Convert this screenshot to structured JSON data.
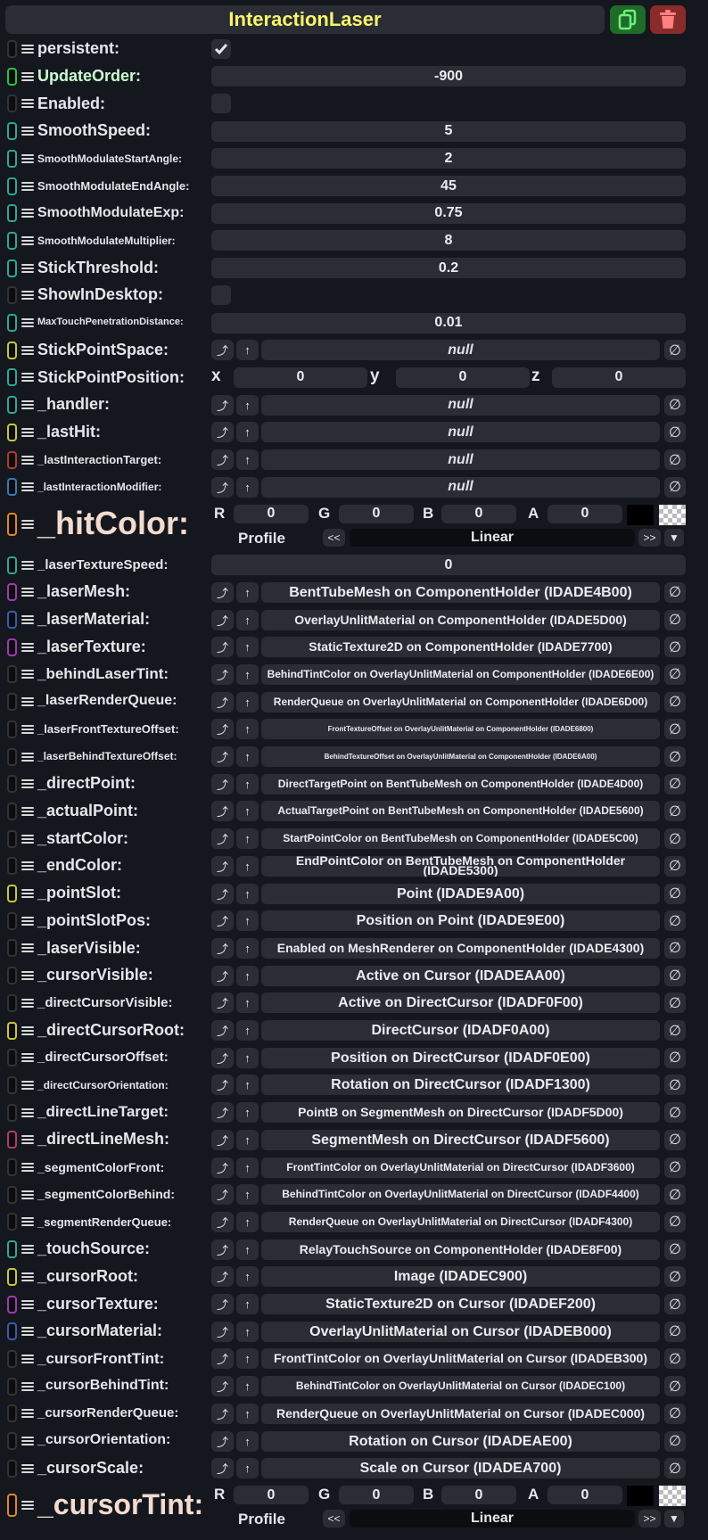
{
  "component": {
    "title": "InteractionLaser",
    "duplicate_icon": "duplicate-icon",
    "delete_icon": "trash-icon"
  },
  "colors": {
    "title": "#f7f56a",
    "panel": "#15171e",
    "field": "#2b2d35",
    "duplicate_button": "#1f6b2a",
    "delete_button": "#8a2b2b",
    "label_value_type": "#c9ffd0",
    "label_color_field": "#f3dccf"
  },
  "icons": {
    "drag": "drag-handle-icon",
    "checkmark": "checkmark-icon",
    "open": "open-reference-icon",
    "up": "up-arrow-icon",
    "clear": "clear-null-icon",
    "dropdown": "dropdown-arrow-icon"
  },
  "ref_buttons": {
    "open": "⤴",
    "up": "↑",
    "clear": "∅"
  },
  "color_field": {
    "r": "R",
    "g": "G",
    "b": "B",
    "a": "A",
    "profile": "Profile",
    "prev": "<<",
    "next": ">>",
    "arrow": "▼"
  },
  "vector_axes": {
    "x": "x",
    "y": "y",
    "z": "z"
  },
  "rows": [
    {
      "label": "persistent:",
      "type": "bool",
      "checked": true,
      "pill": "#333333",
      "size": 18
    },
    {
      "label": "UpdateOrder:",
      "type": "value",
      "value": "-900",
      "pill": "#2cc43a",
      "size": 18,
      "color": "#c9ffd0"
    },
    {
      "label": "Enabled:",
      "type": "bool",
      "checked": false,
      "pill": "#333333",
      "size": 18
    },
    {
      "label": "SmoothSpeed:",
      "type": "value",
      "value": "5",
      "pill": "#2aa89a",
      "size": 18
    },
    {
      "label": "SmoothModulateStartAngle:",
      "type": "value",
      "value": "2",
      "pill": "#2aa89a",
      "size": 12
    },
    {
      "label": "SmoothModulateEndAngle:",
      "type": "value",
      "value": "45",
      "pill": "#2aa89a",
      "size": 13
    },
    {
      "label": "SmoothModulateExp:",
      "type": "value",
      "value": "0.75",
      "pill": "#2aa89a",
      "size": 16
    },
    {
      "label": "SmoothModulateMultiplier:",
      "type": "value",
      "value": "8",
      "pill": "#2aa89a",
      "size": 12
    },
    {
      "label": "StickThreshold:",
      "type": "value",
      "value": "0.2",
      "pill": "#2aa89a",
      "size": 18
    },
    {
      "label": "ShowInDesktop:",
      "type": "bool",
      "checked": false,
      "pill": "#333333",
      "size": 18
    },
    {
      "label": "MaxTouchPenetrationDistance:",
      "type": "value",
      "value": "0.01",
      "pill": "#2aa89a",
      "size": 11
    },
    {
      "label": "StickPointSpace:",
      "type": "ref",
      "value": "null",
      "pill": "#c9c63a",
      "size": 18
    },
    {
      "label": "StickPointPosition:",
      "type": "vec3",
      "x": "0",
      "y": "0",
      "z": "0",
      "pill": "#2aa89a",
      "size": 18
    },
    {
      "label": "_handler:",
      "type": "ref",
      "value": "null",
      "pill": "#2aa89a",
      "size": 18
    },
    {
      "label": "_lastHit:",
      "type": "ref",
      "value": "null",
      "pill": "#c9c63a",
      "size": 18
    },
    {
      "label": "_lastInteractionTarget:",
      "type": "ref",
      "value": "null",
      "pill": "#b03a2e",
      "size": 13
    },
    {
      "label": "_lastInteractionModifier:",
      "type": "ref",
      "value": "null",
      "pill": "#3a7ab0",
      "size": 12
    },
    {
      "label": "_hitColor:",
      "type": "color",
      "r": "0",
      "g": "0",
      "b": "0",
      "a": "0",
      "profile": "Linear",
      "pill": "#e0871f",
      "size": 36
    },
    {
      "label": "_laserTextureSpeed:",
      "type": "value",
      "value": "0",
      "pill": "#2aa89a",
      "size": 15
    },
    {
      "label": "_laserMesh:",
      "type": "ref",
      "value": "BentTubeMesh on ComponentHolder (IDADE4B00)",
      "pill": "#a03ab0",
      "size": 18
    },
    {
      "label": "_laserMaterial:",
      "type": "ref",
      "value": "OverlayUnlitMaterial on ComponentHolder (IDADE5D00)",
      "pill": "#3a5ab0",
      "size": 18
    },
    {
      "label": "_laserTexture:",
      "type": "ref",
      "value": "StaticTexture2D on ComponentHolder (IDADE7700)",
      "pill": "#a03ab0",
      "size": 18
    },
    {
      "label": "_behindLaserTint:",
      "type": "ref",
      "value": "BehindTintColor on OverlayUnlitMaterial on ComponentHolder (IDADE6E00)",
      "pill": "#333333",
      "size": 17
    },
    {
      "label": "_laserRenderQueue:",
      "type": "ref",
      "value": "RenderQueue on OverlayUnlitMaterial on ComponentHolder (IDADE6D00)",
      "pill": "#333333",
      "size": 16
    },
    {
      "label": "_laserFrontTextureOffset:",
      "type": "ref",
      "value": "FrontTextureOffset on OverlayUnlitMaterial on ComponentHolder (IDADE6800)",
      "pill": "#333333",
      "size": 13,
      "small": true
    },
    {
      "label": "_laserBehindTextureOffset:",
      "type": "ref",
      "value": "BehindTextureOffset on OverlayUnlitMaterial on ComponentHolder (IDADE6A00)",
      "pill": "#333333",
      "size": 12,
      "small": true
    },
    {
      "label": "_directPoint:",
      "type": "ref",
      "value": "DirectTargetPoint on BentTubeMesh on ComponentHolder (IDADE4D00)",
      "pill": "#333333",
      "size": 18
    },
    {
      "label": "_actualPoint:",
      "type": "ref",
      "value": "ActualTargetPoint on BentTubeMesh on ComponentHolder (IDADE5600)",
      "pill": "#333333",
      "size": 18
    },
    {
      "label": "_startColor:",
      "type": "ref",
      "value": "StartPointColor on BentTubeMesh on ComponentHolder (IDADE5C00)",
      "pill": "#333333",
      "size": 18
    },
    {
      "label": "_endColor:",
      "type": "ref",
      "value": "EndPointColor on BentTubeMesh on ComponentHolder (IDADE5300)",
      "pill": "#333333",
      "size": 18
    },
    {
      "label": "_pointSlot:",
      "type": "ref",
      "value": "Point (IDADE9A00)",
      "pill": "#c9c63a",
      "size": 18
    },
    {
      "label": "_pointSlotPos:",
      "type": "ref",
      "value": "Position on Point (IDADE9E00)",
      "pill": "#333333",
      "size": 18
    },
    {
      "label": "_laserVisible:",
      "type": "ref",
      "value": "Enabled on MeshRenderer on ComponentHolder (IDADE4300)",
      "pill": "#333333",
      "size": 18
    },
    {
      "label": "_cursorVisible:",
      "type": "ref",
      "value": "Active on Cursor (IDADEAA00)",
      "pill": "#333333",
      "size": 18
    },
    {
      "label": "_directCursorVisible:",
      "type": "ref",
      "value": "Active on DirectCursor (IDADF0F00)",
      "pill": "#333333",
      "size": 15
    },
    {
      "label": "_directCursorRoot:",
      "type": "ref",
      "value": "DirectCursor (IDADF0A00)",
      "pill": "#c9c63a",
      "size": 18
    },
    {
      "label": "_directCursorOffset:",
      "type": "ref",
      "value": "Position on DirectCursor (IDADF0E00)",
      "pill": "#333333",
      "size": 15
    },
    {
      "label": "_directCursorOrientation:",
      "type": "ref",
      "value": "Rotation on DirectCursor (IDADF1300)",
      "pill": "#333333",
      "size": 12
    },
    {
      "label": "_directLineTarget:",
      "type": "ref",
      "value": "PointB on SegmentMesh on DirectCursor (IDADF5D00)",
      "pill": "#333333",
      "size": 17
    },
    {
      "label": "_directLineMesh:",
      "type": "ref",
      "value": "SegmentMesh on DirectCursor (IDADF5600)",
      "pill": "#b03a6a",
      "size": 18
    },
    {
      "label": "_segmentColorFront:",
      "type": "ref",
      "value": "FrontTintColor on OverlayUnlitMaterial on DirectCursor (IDADF3600)",
      "pill": "#333333",
      "size": 14
    },
    {
      "label": "_segmentColorBehind:",
      "type": "ref",
      "value": "BehindTintColor on OverlayUnlitMaterial on DirectCursor (IDADF4400)",
      "pill": "#333333",
      "size": 14
    },
    {
      "label": "_segmentRenderQueue:",
      "type": "ref",
      "value": "RenderQueue on OverlayUnlitMaterial on DirectCursor (IDADF4300)",
      "pill": "#333333",
      "size": 13
    },
    {
      "label": "_touchSource:",
      "type": "ref",
      "value": "RelayTouchSource on ComponentHolder (IDADE8F00)",
      "pill": "#2aa89a",
      "size": 18
    },
    {
      "label": "_cursorRoot:",
      "type": "ref",
      "value": "Image (IDADEC900)",
      "pill": "#c9c63a",
      "size": 18
    },
    {
      "label": "_cursorTexture:",
      "type": "ref",
      "value": "StaticTexture2D on Cursor (IDADEF200)",
      "pill": "#a03ab0",
      "size": 18
    },
    {
      "label": "_cursorMaterial:",
      "type": "ref",
      "value": "OverlayUnlitMaterial on Cursor (IDADEB000)",
      "pill": "#3a5ab0",
      "size": 18
    },
    {
      "label": "_cursorFrontTint:",
      "type": "ref",
      "value": "FrontTintColor on OverlayUnlitMaterial on Cursor (IDADEB300)",
      "pill": "#333333",
      "size": 17
    },
    {
      "label": "_cursorBehindTint:",
      "type": "ref",
      "value": "BehindTintColor on OverlayUnlitMaterial on Cursor (IDADEC100)",
      "pill": "#333333",
      "size": 16
    },
    {
      "label": "_cursorRenderQueue:",
      "type": "ref",
      "value": "RenderQueue on OverlayUnlitMaterial on Cursor (IDADEC000)",
      "pill": "#333333",
      "size": 15
    },
    {
      "label": "_cursorOrientation:",
      "type": "ref",
      "value": "Rotation on Cursor (IDADEAE00)",
      "pill": "#333333",
      "size": 16
    },
    {
      "label": "_cursorScale:",
      "type": "ref",
      "value": "Scale on Cursor (IDADEA700)",
      "pill": "#333333",
      "size": 18
    },
    {
      "label": "_cursorTint:",
      "type": "color",
      "r": "0",
      "g": "0",
      "b": "0",
      "a": "0",
      "profile": "Linear",
      "pill": "#e0871f",
      "size": 32
    }
  ]
}
